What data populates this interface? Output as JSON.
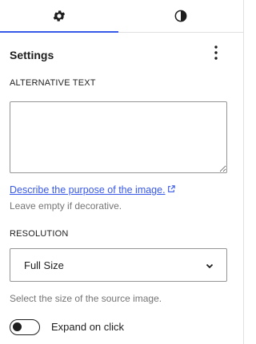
{
  "tabs": [
    {
      "name": "settings",
      "icon": "gear-icon",
      "active": true
    },
    {
      "name": "styles",
      "icon": "half-circle-contrast-icon",
      "active": false
    }
  ],
  "header": {
    "title": "Settings",
    "options_icon": "vertical-ellipsis-icon"
  },
  "alt_text": {
    "label": "ALTERNATIVE TEXT",
    "value": "",
    "link_text": "Describe the purpose of the image.",
    "link_icon": "external-link-icon",
    "help": "Leave empty if decorative."
  },
  "resolution": {
    "label": "RESOLUTION",
    "selected": "Full Size",
    "help": "Select the size of the source image."
  },
  "expand": {
    "label": "Expand on click",
    "enabled": false
  },
  "colors": {
    "accent": "#3858e9",
    "text": "#1e1e1e",
    "muted": "#757575",
    "border": "#949494"
  }
}
